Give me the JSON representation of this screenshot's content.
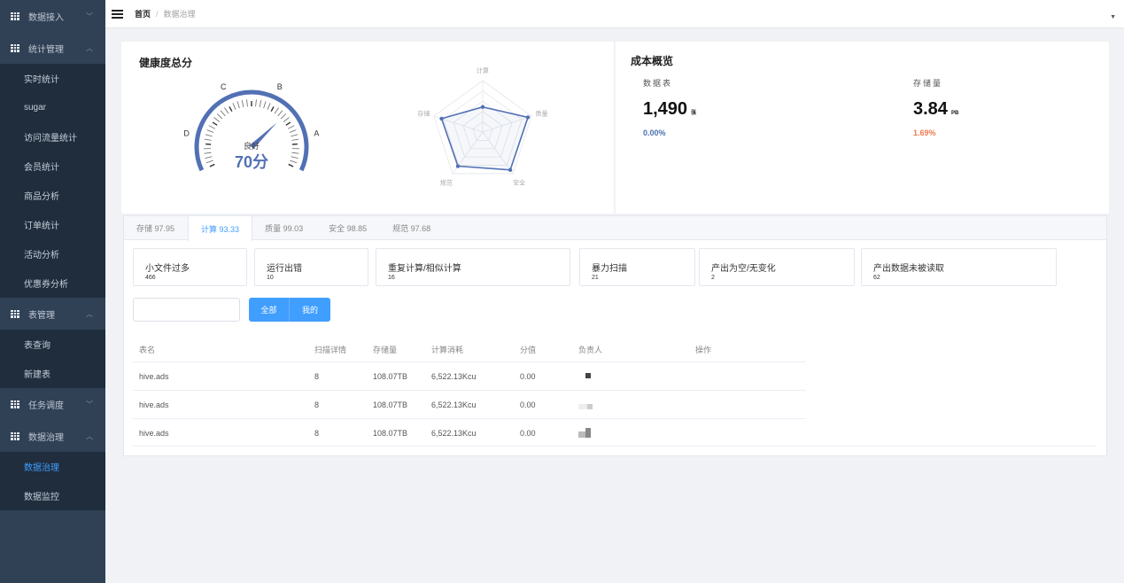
{
  "sidebar": {
    "groups": [
      {
        "label": "数据接入",
        "expanded": false,
        "items": []
      },
      {
        "label": "统计管理",
        "expanded": true,
        "items": [
          "实时统计",
          "sugar",
          "访问流量统计",
          "会员统计",
          "商品分析",
          "订单统计",
          "活动分析",
          "优惠券分析"
        ]
      },
      {
        "label": "表管理",
        "expanded": true,
        "items": [
          "表查询",
          "新建表"
        ]
      },
      {
        "label": "任务调度",
        "expanded": false,
        "items": []
      },
      {
        "label": "数据治理",
        "expanded": true,
        "items": [
          "数据治理",
          "数据监控"
        ]
      }
    ],
    "active_item": "数据治理"
  },
  "header": {
    "breadcrumb": [
      "首页",
      "数据治理"
    ]
  },
  "health": {
    "title": "健康度总分",
    "gauge": {
      "grades": [
        "D",
        "C",
        "B",
        "A"
      ],
      "status": "良好",
      "score_text": "70分",
      "score": 70
    },
    "radar": {
      "axes": [
        "计算",
        "质量",
        "安全",
        "规范",
        "存储"
      ],
      "values": [
        93.33,
        99.03,
        98.85,
        97.68,
        97.95
      ]
    }
  },
  "cost": {
    "title": "成本概览",
    "metrics": [
      {
        "label": "数据表",
        "value": "1,490",
        "unit": "张",
        "change": "0.00%",
        "color": "#4a6fb0"
      },
      {
        "label": "存储量",
        "value": "3.84",
        "unit": "PB",
        "change": "1.69%",
        "color": "#ee7b4e"
      }
    ]
  },
  "tabs": [
    "存储 97.95",
    "计算 93.33",
    "质量 99.03",
    "安全 98.85",
    "规范 97.68"
  ],
  "active_tab": 1,
  "issues": [
    {
      "title": "小文件过多",
      "count": "466"
    },
    {
      "title": "运行出错",
      "count": "10"
    },
    {
      "title": "重复计算/相似计算",
      "count": "16"
    },
    {
      "title": "暴力扫描",
      "count": "21"
    },
    {
      "title": "产出为空/无变化",
      "count": "2"
    },
    {
      "title": "产出数据未被读取",
      "count": "62"
    }
  ],
  "filter": {
    "search_value": "",
    "all_label": "全部",
    "mine_label": "我的"
  },
  "table": {
    "headers": [
      "表名",
      "扫描详情",
      "存储量",
      "计算消耗",
      "分值",
      "负责人",
      "操作"
    ],
    "rows": [
      [
        "hive.ads",
        "8",
        "108.07TB",
        "6,522.13Kcu",
        "0.00"
      ],
      [
        "hive.ads",
        "8",
        "108.07TB",
        "6,522.13Kcu",
        "0.00"
      ],
      [
        "hive.ads",
        "8",
        "108.07TB",
        "6,522.13Kcu",
        "0.00"
      ]
    ]
  },
  "colors": {
    "sidebar_bg": "#304156",
    "accent": "#409eff",
    "gauge": "#5270b4"
  }
}
